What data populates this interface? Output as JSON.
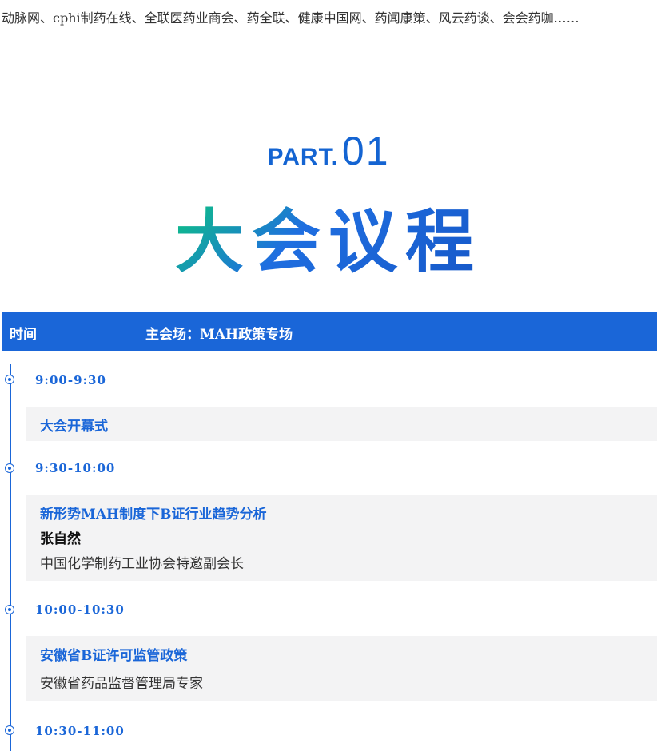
{
  "intro_text": "动脉网、cphi制药在线、全联医药业商会、药全联、健康中国网、药闻康策、风云药谈、会会药咖……",
  "section": {
    "part_label": "PART.",
    "part_number": "01",
    "title": "大会议程"
  },
  "table_header": {
    "time_label": "时间",
    "venue_label": "主会场：MAH政策专场"
  },
  "agenda": [
    {
      "time": "9:00-9:30",
      "title": "大会开幕式",
      "speaker": "",
      "role": ""
    },
    {
      "time": "9:30-10:00",
      "title": "新形势MAH制度下B证行业趋势分析",
      "speaker": "张自然",
      "role": "中国化学制药工业协会特邀副会长"
    },
    {
      "time": "10:00-10:30",
      "title": "安徽省B证许可监管政策",
      "speaker": "",
      "role": "安徽省药品监督管理局专家"
    },
    {
      "time": "10:30-11:00"
    }
  ],
  "colors": {
    "accent": "#1a66d8",
    "card_bg": "#f3f3f4",
    "gradient_green": "#0bc67e"
  }
}
